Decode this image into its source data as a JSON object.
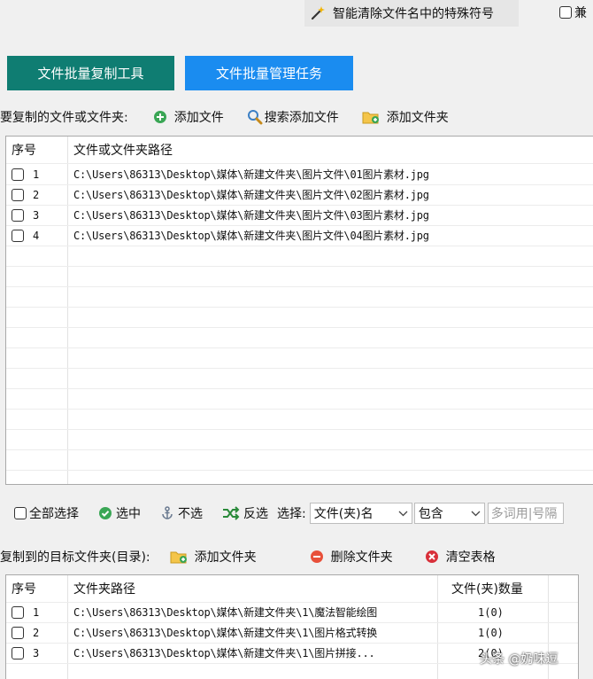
{
  "top": {
    "smart_clean_label": "智能清除文件名中的特殊符号",
    "compat_label": "兼"
  },
  "tabs": [
    {
      "label": "文件批量复制工具",
      "color": "#0f7d72"
    },
    {
      "label": "文件批量管理任务",
      "color": "#1a8cf0"
    }
  ],
  "source": {
    "section_label": "要复制的文件或文件夹:",
    "add_file_label": "添加文件",
    "search_add_label": "搜索添加文件",
    "add_folder_label": "添加文件夹",
    "col_index": "序号",
    "col_path": "文件或文件夹路径",
    "rows": [
      {
        "index": "1",
        "path": "C:\\Users\\86313\\Desktop\\媒体\\新建文件夹\\图片文件\\01图片素材.jpg"
      },
      {
        "index": "2",
        "path": "C:\\Users\\86313\\Desktop\\媒体\\新建文件夹\\图片文件\\02图片素材.jpg"
      },
      {
        "index": "3",
        "path": "C:\\Users\\86313\\Desktop\\媒体\\新建文件夹\\图片文件\\03图片素材.jpg"
      },
      {
        "index": "4",
        "path": "C:\\Users\\86313\\Desktop\\媒体\\新建文件夹\\图片文件\\04图片素材.jpg"
      }
    ]
  },
  "selection": {
    "select_all_label": "全部选择",
    "check_label": "选中",
    "uncheck_label": "不选",
    "invert_label": "反选",
    "filter_label": "选择:",
    "filter_field_value": "文件(夹)名",
    "filter_mode_value": "包含",
    "keyword_placeholder": "多词用|号隔"
  },
  "target": {
    "section_label": "复制到的目标文件夹(目录):",
    "add_folder_label": "添加文件夹",
    "delete_folder_label": "删除文件夹",
    "clear_table_label": "清空表格",
    "col_index": "序号",
    "col_path": "文件夹路径",
    "col_count": "文件(夹)数量",
    "rows": [
      {
        "index": "1",
        "path": "C:\\Users\\86313\\Desktop\\媒体\\新建文件夹\\1\\魔法智能绘图",
        "count": "1(0)"
      },
      {
        "index": "2",
        "path": "C:\\Users\\86313\\Desktop\\媒体\\新建文件夹\\1\\图片格式转换",
        "count": "1(0)"
      },
      {
        "index": "3",
        "path": "C:\\Users\\86313\\Desktop\\媒体\\新建文件夹\\1\\图片拼接...",
        "count": "2(0)"
      }
    ]
  },
  "watermark": "头条 @奶味逗"
}
